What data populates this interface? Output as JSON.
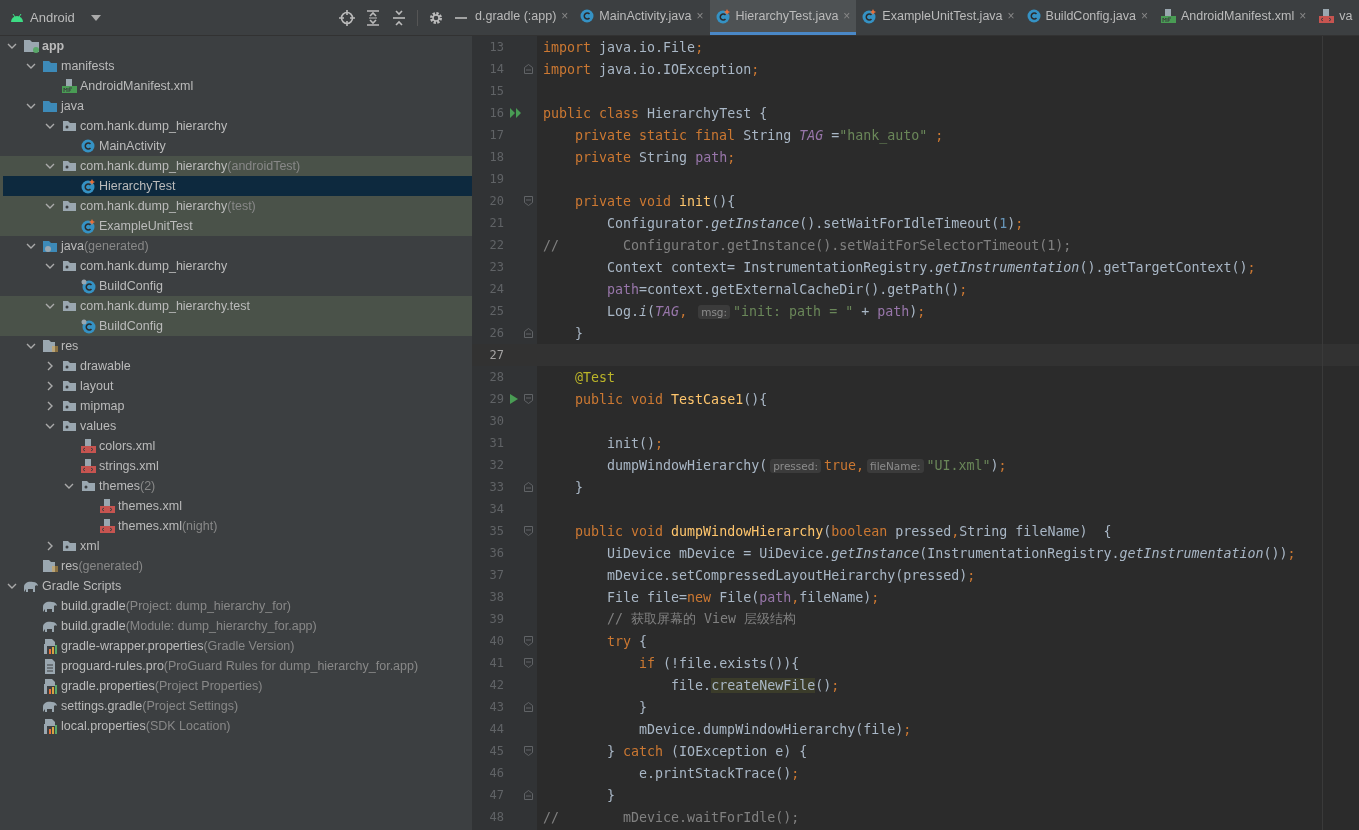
{
  "project_panel": {
    "title": "Android"
  },
  "tabs": [
    {
      "label": "d.gradle (:app)",
      "kind": "plain",
      "close": "×",
      "selected": false
    },
    {
      "label": "MainActivity.java",
      "kind": "class",
      "close": "×",
      "selected": false
    },
    {
      "label": "HierarchyTest.java",
      "kind": "test-class",
      "close": "×",
      "selected": true
    },
    {
      "label": "ExampleUnitTest.java",
      "kind": "test-class",
      "close": "×",
      "selected": false
    },
    {
      "label": "BuildConfig.java",
      "kind": "class",
      "close": "×",
      "selected": false
    },
    {
      "label": "AndroidManifest.xml",
      "kind": "manifest",
      "close": "×",
      "selected": false
    },
    {
      "label": "va",
      "kind": "xml",
      "selected": false
    }
  ],
  "project_tree": [
    {
      "label": "app",
      "kind": "module",
      "expanded": true,
      "selected": false,
      "tinted": false,
      "children": [
        {
          "label": "manifests",
          "kind": "folder",
          "expanded": true,
          "selected": false,
          "tinted": false,
          "children": [
            {
              "label": "AndroidManifest.xml",
              "kind": "manifest",
              "selected": false,
              "tinted": false
            }
          ]
        },
        {
          "label": "java",
          "kind": "folder",
          "expanded": true,
          "selected": false,
          "tinted": false,
          "children": [
            {
              "label": "com.hank.dump_hierarchy",
              "kind": "package",
              "expanded": true,
              "selected": false,
              "tinted": false,
              "children": [
                {
                  "label": "MainActivity",
                  "kind": "class",
                  "selected": false,
                  "tinted": false
                }
              ]
            },
            {
              "label": "com.hank.dump_hierarchy",
              "suffix": "(androidTest)",
              "kind": "package",
              "expanded": true,
              "selected": false,
              "tinted": true,
              "children": [
                {
                  "label": "HierarchyTest",
                  "kind": "test-class",
                  "selected": true,
                  "tinted": true
                }
              ]
            },
            {
              "label": "com.hank.dump_hierarchy",
              "suffix": "(test)",
              "kind": "package",
              "expanded": true,
              "selected": false,
              "tinted": true,
              "children": [
                {
                  "label": "ExampleUnitTest",
                  "kind": "test-class",
                  "selected": false,
                  "tinted": true
                }
              ]
            }
          ]
        },
        {
          "label": "java",
          "suffix": "(generated)",
          "kind": "generated-folder",
          "expanded": true,
          "selected": false,
          "tinted": false,
          "children": [
            {
              "label": "com.hank.dump_hierarchy",
              "kind": "package",
              "expanded": true,
              "selected": false,
              "tinted": false,
              "children": [
                {
                  "label": "BuildConfig",
                  "kind": "locked-class",
                  "selected": false,
                  "tinted": false
                }
              ]
            },
            {
              "label": "com.hank.dump_hierarchy.test",
              "kind": "package",
              "expanded": true,
              "selected": false,
              "tinted": true,
              "children": [
                {
                  "label": "BuildConfig",
                  "kind": "locked-class",
                  "selected": false,
                  "tinted": true
                }
              ]
            }
          ]
        },
        {
          "label": "res",
          "kind": "res-folder",
          "expanded": true,
          "selected": false,
          "tinted": false,
          "children": [
            {
              "label": "drawable",
              "kind": "package",
              "expanded": false,
              "selected": false,
              "tinted": false
            },
            {
              "label": "layout",
              "kind": "package",
              "expanded": false,
              "selected": false,
              "tinted": false
            },
            {
              "label": "mipmap",
              "kind": "package",
              "expanded": false,
              "selected": false,
              "tinted": false
            },
            {
              "label": "values",
              "kind": "package",
              "expanded": true,
              "selected": false,
              "tinted": false,
              "children": [
                {
                  "label": "colors.xml",
                  "kind": "xml",
                  "selected": false,
                  "tinted": false
                },
                {
                  "label": "strings.xml",
                  "kind": "xml",
                  "selected": false,
                  "tinted": false
                },
                {
                  "label": "themes",
                  "suffix": "(2)",
                  "kind": "package",
                  "expanded": true,
                  "selected": false,
                  "tinted": false,
                  "children": [
                    {
                      "label": "themes.xml",
                      "kind": "xml",
                      "selected": false,
                      "tinted": false
                    },
                    {
                      "label": "themes.xml",
                      "suffix": "(night)",
                      "kind": "xml",
                      "selected": false,
                      "tinted": false
                    }
                  ]
                }
              ]
            },
            {
              "label": "xml",
              "kind": "package",
              "expanded": false,
              "selected": false,
              "tinted": false
            }
          ]
        },
        {
          "label": "res",
          "suffix": "(generated)",
          "kind": "res-folder",
          "selected": false,
          "tinted": false
        }
      ]
    },
    {
      "label": "Gradle Scripts",
      "kind": "gradle",
      "expanded": true,
      "selected": false,
      "tinted": false,
      "children": [
        {
          "label": "build.gradle",
          "suffix": "(Project: dump_hierarchy_for)",
          "kind": "gradle",
          "selected": false,
          "tinted": false
        },
        {
          "label": "build.gradle",
          "suffix": "(Module: dump_hierarchy_for.app)",
          "kind": "gradle",
          "selected": false,
          "tinted": false
        },
        {
          "label": "gradle-wrapper.properties",
          "suffix": "(Gradle Version)",
          "kind": "properties",
          "selected": false,
          "tinted": false
        },
        {
          "label": "proguard-rules.pro",
          "suffix": "(ProGuard Rules for dump_hierarchy_for.app)",
          "kind": "text-file",
          "selected": false,
          "tinted": false
        },
        {
          "label": "gradle.properties",
          "suffix": "(Project Properties)",
          "kind": "properties",
          "selected": false,
          "tinted": false
        },
        {
          "label": "settings.gradle",
          "suffix": "(Project Settings)",
          "kind": "gradle",
          "selected": false,
          "tinted": false
        },
        {
          "label": "local.properties",
          "suffix": "(SDK Location)",
          "kind": "properties",
          "selected": false,
          "tinted": false
        }
      ]
    }
  ],
  "editor_lines": [
    {
      "number": "13",
      "current": false,
      "code": [
        {
          "kind": "keyword",
          "text": "import"
        },
        {
          "kind": "plain",
          "text": " java.io.File"
        },
        {
          "kind": "keyword",
          "text": ";"
        }
      ]
    },
    {
      "number": "14",
      "current": false,
      "gutter_marks": [
        {
          "kind": "fold-end"
        }
      ],
      "code": [
        {
          "kind": "keyword",
          "text": "import"
        },
        {
          "kind": "plain",
          "text": " java.io.IOException"
        },
        {
          "kind": "keyword",
          "text": ";"
        }
      ]
    },
    {
      "number": "15",
      "current": false
    },
    {
      "number": "16",
      "current": false,
      "gutter_marks": [
        {
          "kind": "run-all"
        }
      ],
      "code": [
        {
          "kind": "keyword",
          "text": "public class "
        },
        {
          "kind": "plain",
          "text": "HierarchyTest {"
        }
      ]
    },
    {
      "number": "17",
      "current": false,
      "code": [
        {
          "kind": "keyword",
          "text": "    private static final "
        },
        {
          "kind": "plain",
          "text": "String "
        },
        {
          "kind": "static-field",
          "text": "TAG"
        },
        {
          "kind": "plain",
          "text": " ="
        },
        {
          "kind": "string",
          "text": "\"hank_auto\""
        },
        {
          "kind": "keyword",
          "text": " ;"
        }
      ]
    },
    {
      "number": "18",
      "current": false,
      "code": [
        {
          "kind": "keyword",
          "text": "    private "
        },
        {
          "kind": "plain",
          "text": "String "
        },
        {
          "kind": "field",
          "text": "path"
        },
        {
          "kind": "keyword",
          "text": ";"
        }
      ]
    },
    {
      "number": "19",
      "current": false
    },
    {
      "number": "20",
      "current": false,
      "gutter_marks": [
        {
          "kind": "fold-start"
        }
      ],
      "code": [
        {
          "kind": "keyword",
          "text": "    private void "
        },
        {
          "kind": "method",
          "text": "init"
        },
        {
          "kind": "plain",
          "text": "(){"
        }
      ]
    },
    {
      "number": "21",
      "current": false,
      "code": [
        {
          "kind": "plain",
          "text": "        Configurator."
        },
        {
          "kind": "static-call",
          "text": "getInstance"
        },
        {
          "kind": "plain",
          "text": "().setWaitForIdleTimeout("
        },
        {
          "kind": "number",
          "text": "1"
        },
        {
          "kind": "plain",
          "text": ")"
        },
        {
          "kind": "keyword",
          "text": ";"
        }
      ]
    },
    {
      "number": "22",
      "current": false,
      "code": [
        {
          "kind": "comment",
          "text": "//        Configurator.getInstance().setWaitForSelectorTimeout(1);"
        }
      ]
    },
    {
      "number": "23",
      "current": false,
      "code": [
        {
          "kind": "plain",
          "text": "        Context context= InstrumentationRegistry."
        },
        {
          "kind": "static-call",
          "text": "getInstrumentation"
        },
        {
          "kind": "plain",
          "text": "().getTargetContext()"
        },
        {
          "kind": "keyword",
          "text": ";"
        }
      ]
    },
    {
      "number": "24",
      "current": false,
      "code": [
        {
          "kind": "field",
          "text": "        path"
        },
        {
          "kind": "plain",
          "text": "=context.getExternalCacheDir().getPath()"
        },
        {
          "kind": "keyword",
          "text": ";"
        }
      ]
    },
    {
      "number": "25",
      "current": false,
      "code": [
        {
          "kind": "plain",
          "text": "        Log."
        },
        {
          "kind": "static-call",
          "text": "i"
        },
        {
          "kind": "plain",
          "text": "("
        },
        {
          "kind": "static-field",
          "text": "TAG"
        },
        {
          "kind": "keyword",
          "text": ", "
        },
        {
          "kind": "hint",
          "text": "msg:"
        },
        {
          "kind": "string",
          "text": "\"init: path = \""
        },
        {
          "kind": "plain",
          "text": " + "
        },
        {
          "kind": "field",
          "text": "path"
        },
        {
          "kind": "plain",
          "text": ")"
        },
        {
          "kind": "keyword",
          "text": ";"
        }
      ]
    },
    {
      "number": "26",
      "current": false,
      "gutter_marks": [
        {
          "kind": "fold-end"
        }
      ],
      "code": [
        {
          "kind": "plain",
          "text": "    }"
        }
      ]
    },
    {
      "number": "27",
      "current": true
    },
    {
      "number": "28",
      "current": false,
      "code": [
        {
          "kind": "annotation",
          "text": "    @Test"
        }
      ]
    },
    {
      "number": "29",
      "current": false,
      "gutter_marks": [
        {
          "kind": "run"
        },
        {
          "kind": "fold-start"
        }
      ],
      "code": [
        {
          "kind": "keyword",
          "text": "    public void "
        },
        {
          "kind": "method",
          "text": "TestCase1"
        },
        {
          "kind": "plain",
          "text": "(){"
        }
      ]
    },
    {
      "number": "30",
      "current": false
    },
    {
      "number": "31",
      "current": false,
      "code": [
        {
          "kind": "plain",
          "text": "        init()"
        },
        {
          "kind": "keyword",
          "text": ";"
        }
      ]
    },
    {
      "number": "32",
      "current": false,
      "code": [
        {
          "kind": "plain",
          "text": "        dumpWindowHierarchy("
        },
        {
          "kind": "hint",
          "text": "pressed:"
        },
        {
          "kind": "keyword",
          "text": "true,"
        },
        {
          "kind": "hint",
          "text": "fileName:"
        },
        {
          "kind": "string",
          "text": "\"UI.xml\""
        },
        {
          "kind": "plain",
          "text": ")"
        },
        {
          "kind": "keyword",
          "text": ";"
        }
      ]
    },
    {
      "number": "33",
      "current": false,
      "gutter_marks": [
        {
          "kind": "fold-end"
        }
      ],
      "code": [
        {
          "kind": "plain",
          "text": "    }"
        }
      ]
    },
    {
      "number": "34",
      "current": false
    },
    {
      "number": "35",
      "current": false,
      "gutter_marks": [
        {
          "kind": "fold-start"
        }
      ],
      "code": [
        {
          "kind": "keyword",
          "text": "    public void "
        },
        {
          "kind": "method",
          "text": "dumpWindowHierarchy"
        },
        {
          "kind": "plain",
          "text": "("
        },
        {
          "kind": "keyword",
          "text": "boolean "
        },
        {
          "kind": "plain",
          "text": "pressed"
        },
        {
          "kind": "keyword",
          "text": ","
        },
        {
          "kind": "plain",
          "text": "String fileName)  {"
        }
      ]
    },
    {
      "number": "36",
      "current": false,
      "code": [
        {
          "kind": "plain",
          "text": "        UiDevice mDevice = UiDevice."
        },
        {
          "kind": "static-call",
          "text": "getInstance"
        },
        {
          "kind": "plain",
          "text": "(InstrumentationRegistry."
        },
        {
          "kind": "static-call",
          "text": "getInstrumentation"
        },
        {
          "kind": "plain",
          "text": "())"
        },
        {
          "kind": "keyword",
          "text": ";"
        }
      ]
    },
    {
      "number": "37",
      "current": false,
      "code": [
        {
          "kind": "plain",
          "text": "        mDevice.setCompressedLayoutHeirarchy(pressed)"
        },
        {
          "kind": "keyword",
          "text": ";"
        }
      ]
    },
    {
      "number": "38",
      "current": false,
      "code": [
        {
          "kind": "plain",
          "text": "        File file="
        },
        {
          "kind": "keyword",
          "text": "new "
        },
        {
          "kind": "plain",
          "text": "File("
        },
        {
          "kind": "field",
          "text": "path"
        },
        {
          "kind": "keyword",
          "text": ","
        },
        {
          "kind": "plain",
          "text": "fileName)"
        },
        {
          "kind": "keyword",
          "text": ";"
        }
      ]
    },
    {
      "number": "39",
      "current": false,
      "code": [
        {
          "kind": "comment",
          "text": "        // 获取屏幕的 View 层级结构"
        }
      ]
    },
    {
      "number": "40",
      "current": false,
      "gutter_marks": [
        {
          "kind": "fold-start"
        }
      ],
      "code": [
        {
          "kind": "keyword",
          "text": "        try "
        },
        {
          "kind": "plain",
          "text": "{"
        }
      ]
    },
    {
      "number": "41",
      "current": false,
      "gutter_marks": [
        {
          "kind": "fold-start"
        }
      ],
      "code": [
        {
          "kind": "keyword",
          "text": "            if "
        },
        {
          "kind": "plain",
          "text": "(!file.exists()){"
        }
      ]
    },
    {
      "number": "42",
      "current": false,
      "code": [
        {
          "kind": "plain",
          "text": "                file."
        },
        {
          "kind": "highlighted",
          "text": "createNewFile"
        },
        {
          "kind": "plain",
          "text": "()"
        },
        {
          "kind": "keyword",
          "text": ";"
        }
      ]
    },
    {
      "number": "43",
      "current": false,
      "gutter_marks": [
        {
          "kind": "fold-end"
        }
      ],
      "code": [
        {
          "kind": "plain",
          "text": "            }"
        }
      ]
    },
    {
      "number": "44",
      "current": false,
      "code": [
        {
          "kind": "plain",
          "text": "            mDevice.dumpWindowHierarchy(file)"
        },
        {
          "kind": "keyword",
          "text": ";"
        }
      ]
    },
    {
      "number": "45",
      "current": false,
      "gutter_marks": [
        {
          "kind": "fold-start"
        }
      ],
      "code": [
        {
          "kind": "plain",
          "text": "        } "
        },
        {
          "kind": "keyword",
          "text": "catch "
        },
        {
          "kind": "plain",
          "text": "(IOException e) {"
        }
      ]
    },
    {
      "number": "46",
      "current": false,
      "code": [
        {
          "kind": "plain",
          "text": "            e.printStackTrace()"
        },
        {
          "kind": "keyword",
          "text": ";"
        }
      ]
    },
    {
      "number": "47",
      "current": false,
      "gutter_marks": [
        {
          "kind": "fold-end"
        }
      ],
      "code": [
        {
          "kind": "plain",
          "text": "        }"
        }
      ]
    },
    {
      "number": "48",
      "current": false,
      "code": [
        {
          "kind": "comment",
          "text": "//        mDevice.waitForIdle();"
        }
      ]
    }
  ]
}
